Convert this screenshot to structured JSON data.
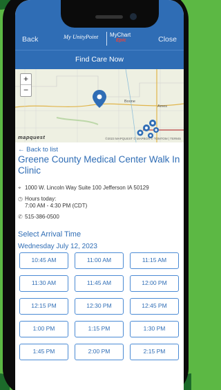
{
  "header": {
    "back_label": "Back",
    "close_label": "Close",
    "logo_primary": "My UnityPoint",
    "logo_secondary": "MyChart",
    "logo_epic": "Epic",
    "title": "Find Care Now"
  },
  "map": {
    "zoom_in": "+",
    "zoom_out": "−",
    "brand": "mapquest",
    "credits": "©2023 MAPQUEST  © MAPBOX  © TOMTOM | TERMS",
    "place_label": "Ames",
    "place_label_2": "Boone"
  },
  "location": {
    "back_link": "← Back to list",
    "name": "Greene County Medical Center Walk In Clinic",
    "address": "1000 W. Lincoln Way Suite 100 Jefferson IA 50129",
    "hours_label": "Hours today:",
    "hours_value": "7:00 AM - 4:30 PM (CDT)",
    "phone": "515-386-0500"
  },
  "arrival": {
    "title": "Select Arrival Time",
    "date": "Wednesday July 12, 2023",
    "slots": [
      "10:45 AM",
      "11:00 AM",
      "11:15 AM",
      "11:30 AM",
      "11:45 AM",
      "12:00 PM",
      "12:15 PM",
      "12:30 PM",
      "12:45 PM",
      "1:00 PM",
      "1:15 PM",
      "1:30 PM",
      "1:45 PM",
      "2:00 PM",
      "2:15 PM"
    ]
  },
  "colors": {
    "brand_blue": "#2f6db5",
    "background_green": "#5cb844",
    "pin_blue": "#2f6db5"
  }
}
